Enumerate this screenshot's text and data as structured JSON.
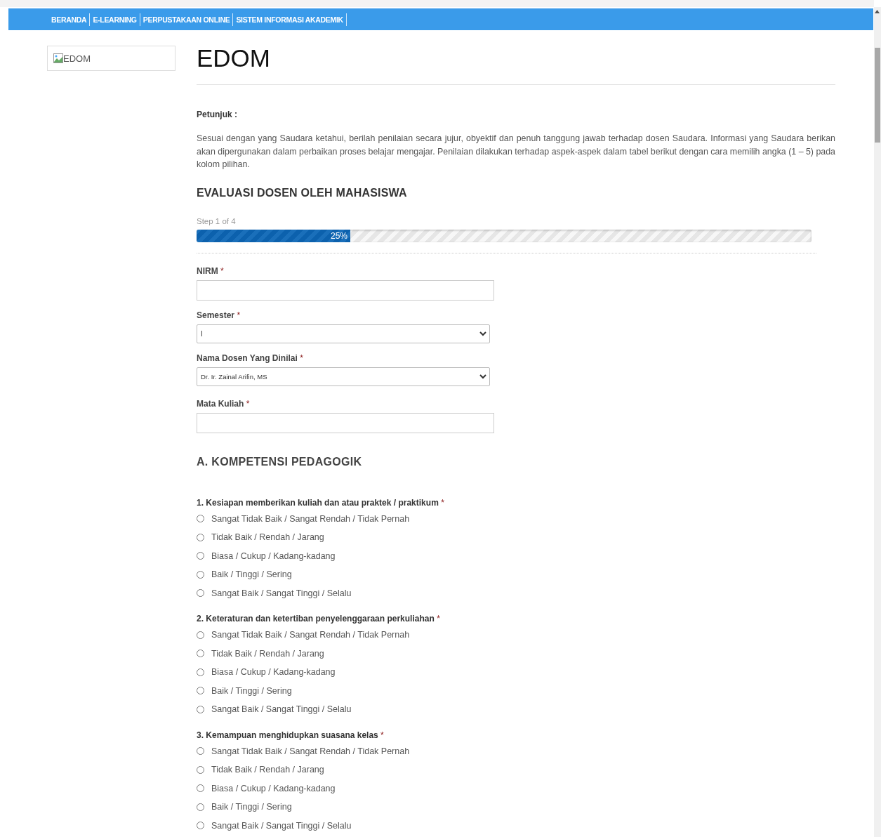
{
  "nav": [
    "BERANDA",
    "E-LEARNING",
    "PERPUSTAKAAN ONLINE",
    "SISTEM INFORMASI AKADEMIK"
  ],
  "logo": {
    "alt": "EDOM"
  },
  "title": "EDOM",
  "instructions": {
    "heading": "Petunjuk :",
    "text": "Sesuai dengan yang Saudara ketahui, berilah penilaian secara jujur, obyektif dan penuh tanggung jawab terhadap dosen Saudara. Informasi yang Saudara berikan akan dipergunakan dalam perbaikan proses belajar mengajar. Penilaian dilakukan terhadap aspek-aspek dalam tabel berikut dengan cara memilih angka (1 – 5) pada kolom pilihan."
  },
  "form_title": "EVALUASI DOSEN OLEH MAHASISWA",
  "progress": {
    "step": "Step 1 of 4",
    "level": 0.25,
    "reading": "25%"
  },
  "fields": [
    {
      "kind": "text",
      "label": "NIRM",
      "mark": "*"
    },
    {
      "kind": "select",
      "label": "Semester",
      "mark": "*",
      "value": "I"
    },
    {
      "kind": "select",
      "label": "Nama Dosen Yang Dinilai",
      "mark": "*",
      "value": "Dr. Ir. Zainal Arifin, MS"
    },
    {
      "kind": "text",
      "label": "Mata Kuliah",
      "mark": "*"
    }
  ],
  "section": "A. KOMPETENSI PEDAGOGIK",
  "questions": [
    {
      "label": "1. Kesiapan memberikan kuliah dan atau praktek / praktikum",
      "mark": "*",
      "options": [
        {
          "label": "Sangat Tidak Baik / Sangat Rendah / Tidak Pernah",
          "selected": false
        },
        {
          "label": "Tidak Baik / Rendah / Jarang",
          "selected": false
        },
        {
          "label": "Biasa / Cukup / Kadang-kadang",
          "selected": false
        },
        {
          "label": "Baik / Tinggi / Sering",
          "selected": false
        },
        {
          "label": "Sangat Baik / Sangat Tinggi / Selalu",
          "selected": false
        }
      ]
    },
    {
      "label": "2. Keteraturan dan ketertiban penyelenggaraan perkuliahan",
      "mark": "*",
      "options": [
        {
          "label": "Sangat Tidak Baik / Sangat Rendah / Tidak Pernah",
          "selected": false
        },
        {
          "label": "Tidak Baik / Rendah / Jarang",
          "selected": false
        },
        {
          "label": "Biasa / Cukup / Kadang-kadang",
          "selected": false
        },
        {
          "label": "Baik / Tinggi / Sering",
          "selected": false
        },
        {
          "label": "Sangat Baik / Sangat Tinggi / Selalu",
          "selected": false
        }
      ]
    },
    {
      "label": "3. Kemampuan menghidupkan suasana kelas",
      "mark": "*",
      "options": [
        {
          "label": "Sangat Tidak Baik / Sangat Rendah / Tidak Pernah",
          "selected": false
        },
        {
          "label": "Tidak Baik / Rendah / Jarang",
          "selected": false
        },
        {
          "label": "Biasa / Cukup / Kadang-kadang",
          "selected": false
        },
        {
          "label": "Baik / Tinggi / Sering",
          "selected": false
        },
        {
          "label": "Sangat Baik / Sangat Tinggi / Selalu",
          "selected": false
        }
      ]
    }
  ]
}
